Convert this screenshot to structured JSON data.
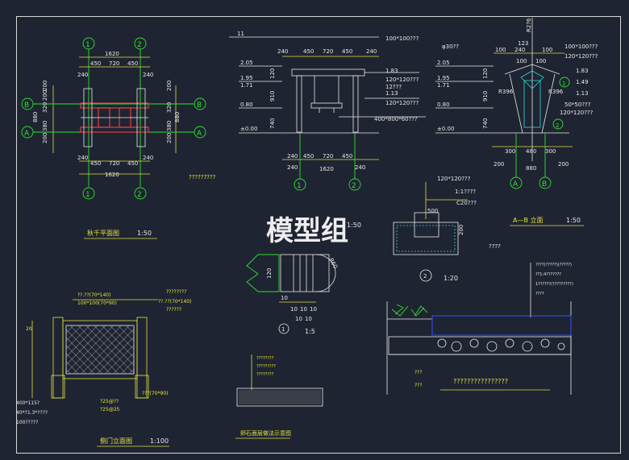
{
  "watermark": "模型组",
  "plan": {
    "axis_top": [
      "1",
      "2"
    ],
    "axis_bottom": [
      "1",
      "2"
    ],
    "axis_left": [
      "B",
      "A"
    ],
    "axis_right": [
      "B",
      "A"
    ],
    "dim_total": "1620",
    "dim_parts": [
      "450",
      "720",
      "450"
    ],
    "dim_ends": [
      "240",
      "240"
    ],
    "dim_side_left": [
      "200",
      "200",
      "320",
      "380",
      "320",
      "200"
    ],
    "dim_side_total": "880",
    "title": "秋千平面图",
    "scale": "1:50"
  },
  "question_note": "?????????",
  "elev1": {
    "dims_top": [
      "240",
      "450",
      "720",
      "450",
      "240"
    ],
    "dims_bottom": [
      "240",
      "450",
      "720",
      "450",
      "240"
    ],
    "total": "1620",
    "levels": [
      "2.05",
      "1.95",
      "1.71",
      "0.80",
      "±0.00"
    ],
    "right_levels": [
      "1.83",
      "1.13"
    ],
    "vdims": [
      "120",
      "910",
      "740"
    ],
    "axes": [
      "1",
      "2"
    ],
    "notes": [
      "100*100???",
      "120*120???",
      "12???",
      "120*120???",
      "400*800*60???"
    ]
  },
  "elev2": {
    "top": "R2?6",
    "dims_top": [
      "123",
      "100",
      "240",
      "100",
      "100",
      "100"
    ],
    "dims_bottom": [
      "300",
      "480",
      "300"
    ],
    "dims_bottom2": [
      "200",
      "880",
      "200"
    ],
    "levels": [
      "2.05",
      "1.95",
      "1.71",
      "0.80",
      "±0.00"
    ],
    "right_levels": [
      "1.83",
      "1.49",
      "1.13"
    ],
    "radii": [
      "R396",
      "R396"
    ],
    "vdims": [
      "120",
      "910",
      "740"
    ],
    "axes": [
      "A",
      "B"
    ],
    "notes": [
      "100*100???",
      "120*120???",
      "100*100???",
      "50*50???",
      "120*120???"
    ],
    "title": "A—B 立面",
    "scale": "1:50",
    "label_top": "φ30??"
  },
  "detail1": {
    "dims": [
      "10",
      "10",
      "10",
      "10",
      "10"
    ],
    "vdims": [
      "120",
      "10"
    ],
    "radius": "R60",
    "num": "1",
    "scale": "1:5"
  },
  "detail2": {
    "dims": [
      "500",
      "200"
    ],
    "notes": [
      "120*120???",
      "1:1????",
      "C20???",
      "????"
    ],
    "num": "2",
    "scale": "1:20",
    "scale_hidden": "1:50"
  },
  "gate": {
    "notes_top": [
      "??.??(70*140)",
      "100*100(70*90)"
    ],
    "notes_right": [
      "??.??(70*140)",
      "????????",
      "??????"
    ],
    "bottom_notes": [
      "400*115?",
      "40*?1.3*????",
      "100?????"
    ],
    "pipes": [
      "?25@??",
      "?25@25"
    ],
    "post": "???(70*90)",
    "title": "侧门立面图",
    "scale": "1:100"
  },
  "paving": {
    "notes": [
      "????????",
      "?????????",
      "????????"
    ],
    "title": "卵石面层做法示意图"
  },
  "section": {
    "notes": [
      "????(?????)(?????)",
      "??1:4???????",
      "1??????(?????????)",
      "????"
    ],
    "notes_bottom": [
      "???",
      "???"
    ],
    "caption": "????????????????"
  }
}
